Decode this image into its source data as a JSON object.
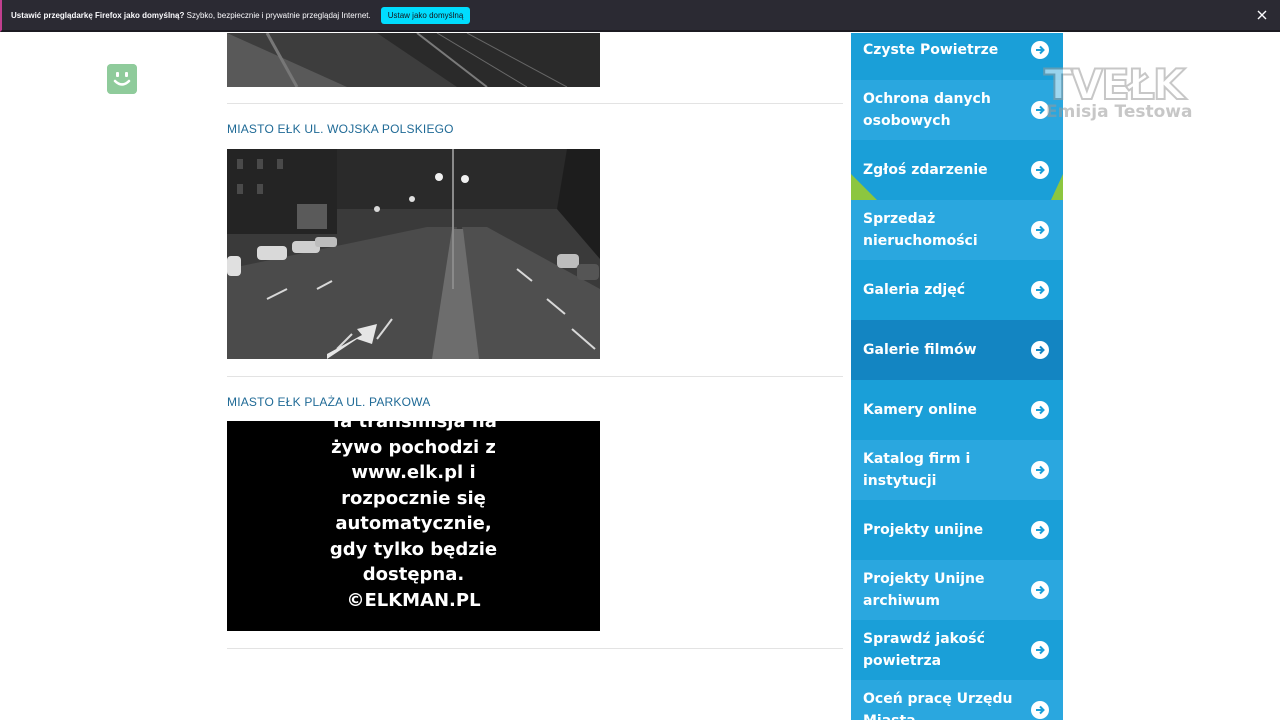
{
  "notification": {
    "bold_text": "Ustawić przeglądarkę Firefox jako domyślną?",
    "text": " Szybko, bezpiecznie i prywatnie przeglądaj Internet.",
    "button_label": "Ustaw jako domyślną"
  },
  "cameras": [
    {
      "title": "MIASTO EŁK UL. WOJSKA POLSKIEGO"
    },
    {
      "title": "MIASTO EŁK PLAŻA UL. PARKOWA"
    }
  ],
  "stream_overlay": {
    "lines": [
      "Ta transmisja na",
      "żywo pochodzi z",
      "www.elk.pl i",
      "rozpocznie się",
      "automatycznie,",
      "gdy tylko będzie",
      "dostępna.",
      "©ELKMAN.PL"
    ]
  },
  "sidebar": {
    "items": [
      {
        "label": "Czyste Powietrze"
      },
      {
        "label": "Ochrona danych osobowych"
      },
      {
        "label": "Zgłoś zdarzenie"
      },
      {
        "label": "Sprzedaż nieruchomości"
      },
      {
        "label": "Galeria zdjęć"
      },
      {
        "label": "Galerie filmów"
      },
      {
        "label": "Kamery online"
      },
      {
        "label": "Katalog firm i instytucji"
      },
      {
        "label": "Projekty unijne"
      },
      {
        "label": "Projekty Unijne archiwum"
      },
      {
        "label": "Sprawdź jakość powietrza"
      },
      {
        "label": "Oceń pracę Urzędu Miasta"
      }
    ]
  },
  "watermark": {
    "logo": "TVEŁK",
    "caption": "Emisja Testowa"
  },
  "colors": {
    "sidebar_blue": "#1a9fd8",
    "sidebar_blue_alt": "#2aa7df",
    "sidebar_blue_dark": "#1385c2",
    "title_blue": "#1f6a96",
    "notif_bg": "#2b2a33",
    "notif_button": "#00ddff",
    "smiley_green": "#8fcb9b"
  }
}
